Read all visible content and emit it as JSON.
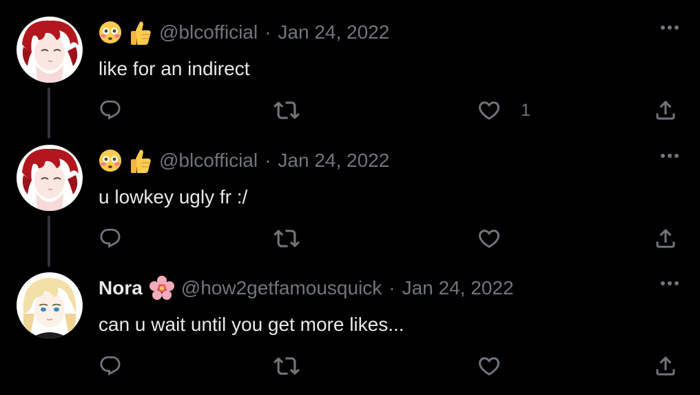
{
  "colors": {
    "background": "#000000",
    "text_primary": "#e7e9ea",
    "text_secondary": "#71767b",
    "thread_line": "#333639"
  },
  "tweets": [
    {
      "name_emoji": [
        "flushed-face-emoji",
        "thumbs-up-emoji"
      ],
      "display_name": "",
      "handle": "@blcofficial",
      "separator": "·",
      "date": "Jan 24, 2022",
      "text": "like for an indirect",
      "likes": "1",
      "avatar": "red-haired-anime-avatar"
    },
    {
      "name_emoji": [
        "flushed-face-emoji",
        "thumbs-up-emoji"
      ],
      "display_name": "",
      "handle": "@blcofficial",
      "separator": "·",
      "date": "Jan 24, 2022",
      "text": "u lowkey ugly fr :/",
      "likes": "",
      "avatar": "red-haired-anime-avatar"
    },
    {
      "name_emoji": [
        "cherry-blossom-emoji"
      ],
      "display_name": "Nora",
      "handle": "@how2getfamousquick",
      "separator": "·",
      "date": "Jan 24, 2022",
      "text": "can u wait until you get more likes...",
      "likes": "",
      "avatar": "blonde-anime-avatar"
    }
  ],
  "icons": {
    "reply": "reply-icon",
    "retweet": "retweet-icon",
    "like": "heart-icon",
    "share": "share-icon",
    "more": "more-options-icon"
  }
}
